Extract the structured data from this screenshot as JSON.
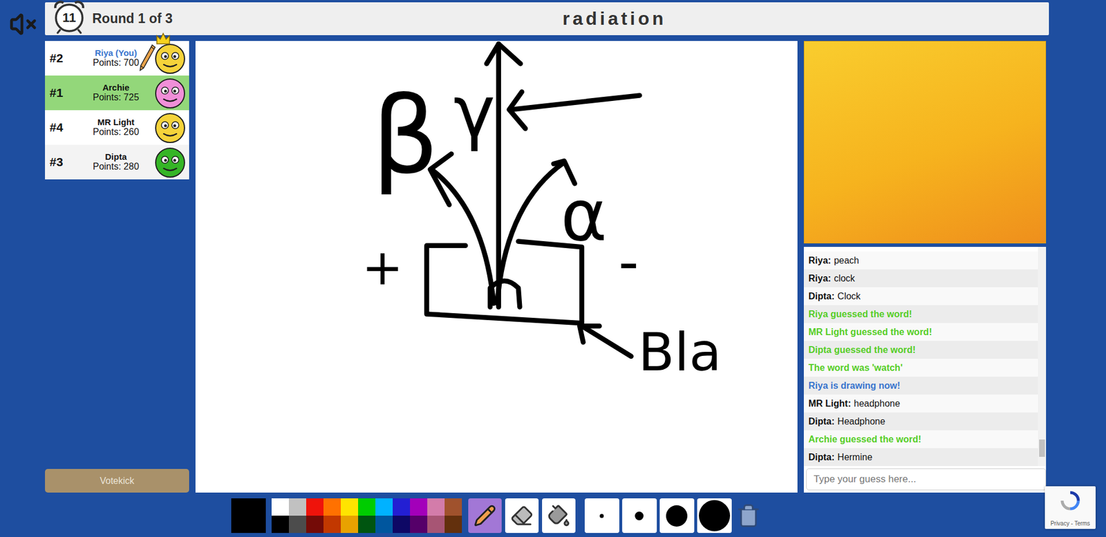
{
  "sound": {
    "muted": true
  },
  "timer": {
    "seconds": "11"
  },
  "round": "Round 1 of 3",
  "word": "radiation",
  "players": [
    {
      "rank": "#2",
      "name": "Riya (You)",
      "points": "Points: 700",
      "is_you": true,
      "drawing": true,
      "crown": true,
      "guessed": false,
      "color": "#f5d33a"
    },
    {
      "rank": "#1",
      "name": "Archie",
      "points": "Points: 725",
      "is_you": false,
      "drawing": false,
      "crown": false,
      "guessed": true,
      "color": "#f08fd8"
    },
    {
      "rank": "#4",
      "name": "MR Light",
      "points": "Points: 260",
      "is_you": false,
      "drawing": false,
      "crown": false,
      "guessed": false,
      "color": "#f5d33a"
    },
    {
      "rank": "#3",
      "name": "Dipta",
      "points": "Points: 280",
      "is_you": false,
      "drawing": false,
      "crown": false,
      "guessed": false,
      "color": "#35b526"
    }
  ],
  "votekick": {
    "label": "Votekick",
    "disabled": true
  },
  "canvas": {
    "labels": [
      {
        "text": "β"
      },
      {
        "text": "γ"
      },
      {
        "text": "α"
      },
      {
        "text": "+"
      },
      {
        "text": "-"
      },
      {
        "text": "Bla"
      }
    ]
  },
  "chat": {
    "messages": [
      {
        "kind": "message",
        "author": "Riya:",
        "text": "peach"
      },
      {
        "kind": "message",
        "author": "Riya:",
        "text": "clock"
      },
      {
        "kind": "message",
        "author": "Dipta:",
        "text": "Clock"
      },
      {
        "kind": "system",
        "text": "Riya guessed the word!",
        "color": "#56ce27"
      },
      {
        "kind": "system",
        "text": "MR Light guessed the word!",
        "color": "#56ce27"
      },
      {
        "kind": "system",
        "text": "Dipta guessed the word!",
        "color": "#56ce27"
      },
      {
        "kind": "system",
        "text": "The word was 'watch'",
        "color": "#56ce27"
      },
      {
        "kind": "system",
        "text": "Riya is drawing now!",
        "color": "#3975ce"
      },
      {
        "kind": "message",
        "author": "MR Light:",
        "text": "headphone"
      },
      {
        "kind": "message",
        "author": "Dipta:",
        "text": "Headphone"
      },
      {
        "kind": "system",
        "text": "Archie guessed the word!",
        "color": "#56ce27"
      },
      {
        "kind": "message",
        "author": "Dipta:",
        "text": "Hermine"
      }
    ]
  },
  "guess_input": {
    "placeholder": "Type your guess here..."
  },
  "toolbar": {
    "current_color": "#000000",
    "palette": [
      {
        "color": "#ffffff",
        "selected": false
      },
      {
        "color": "#c1c1c1",
        "selected": false
      },
      {
        "color": "#ef130b",
        "selected": false
      },
      {
        "color": "#ff7100",
        "selected": false
      },
      {
        "color": "#ffe400",
        "selected": false
      },
      {
        "color": "#00cc00",
        "selected": false
      },
      {
        "color": "#00b2ff",
        "selected": false
      },
      {
        "color": "#231fd3",
        "selected": false
      },
      {
        "color": "#a300ba",
        "selected": false
      },
      {
        "color": "#d37caa",
        "selected": false
      },
      {
        "color": "#a0522d",
        "selected": false
      },
      {
        "color": "#000000",
        "selected": true
      },
      {
        "color": "#4c4c4c",
        "selected": false
      },
      {
        "color": "#740b07",
        "selected": false
      },
      {
        "color": "#c23800",
        "selected": false
      },
      {
        "color": "#e8a200",
        "selected": false
      },
      {
        "color": "#005510",
        "selected": false
      },
      {
        "color": "#00569e",
        "selected": false
      },
      {
        "color": "#0e0865",
        "selected": false
      },
      {
        "color": "#550069",
        "selected": false
      },
      {
        "color": "#a75574",
        "selected": false
      },
      {
        "color": "#63300d",
        "selected": false
      }
    ],
    "tools": [
      {
        "kind": "pencil",
        "selected": true
      },
      {
        "kind": "eraser",
        "selected": false
      },
      {
        "kind": "fill",
        "selected": false
      }
    ],
    "sizes": [
      {
        "selected": false
      },
      {
        "selected": false
      },
      {
        "selected": false
      },
      {
        "selected": false
      }
    ]
  },
  "recaptcha": {
    "links": "Privacy - Terms"
  }
}
